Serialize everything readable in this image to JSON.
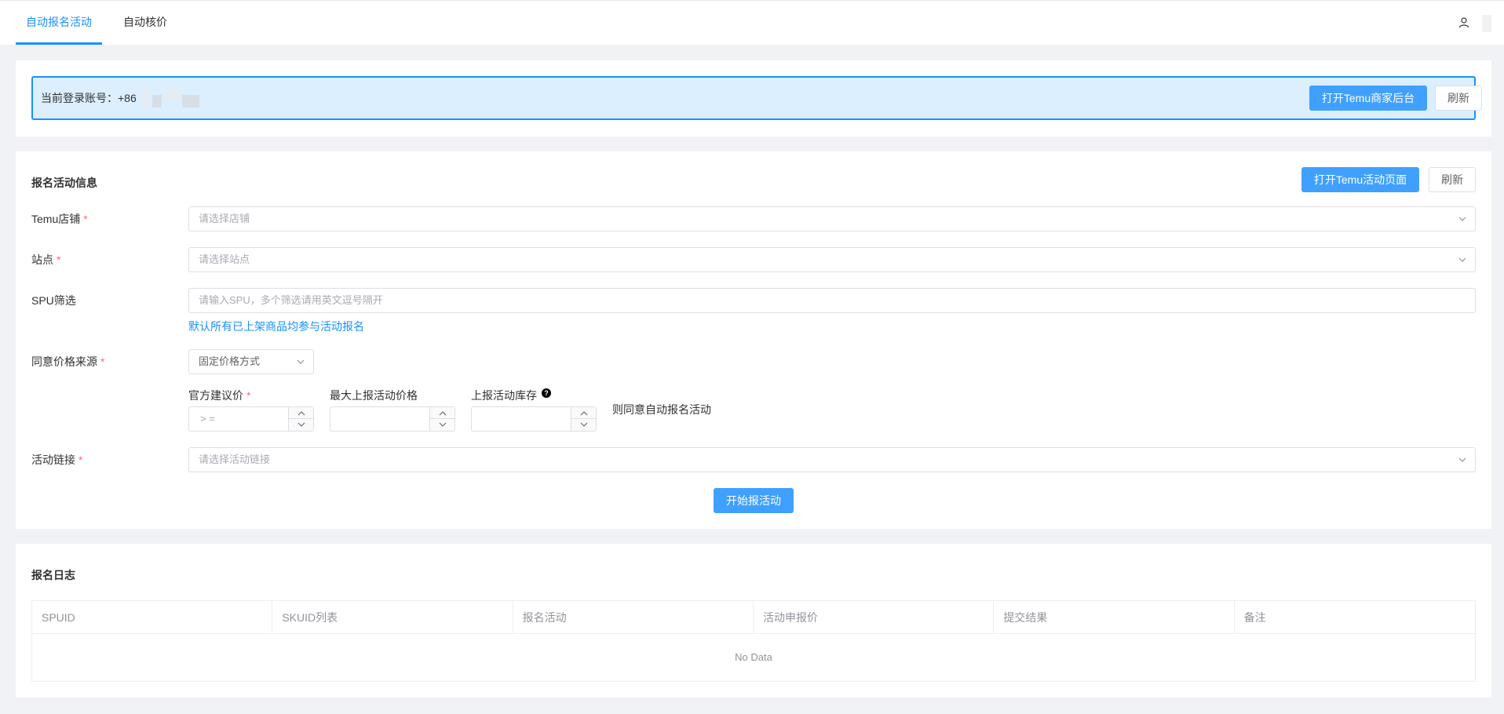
{
  "nav": {
    "tabs": [
      {
        "label": "自动报名活动",
        "active": true
      },
      {
        "label": "自动核价",
        "active": false
      }
    ]
  },
  "account": {
    "label": "当前登录账号：+86",
    "open_backend_label": "打开Temu商家后台",
    "refresh_label": "刷新"
  },
  "form": {
    "title": "报名活动信息",
    "open_activity_label": "打开Temu活动页面",
    "refresh_label": "刷新",
    "store": {
      "label": "Temu店铺",
      "placeholder": "请选择店铺"
    },
    "site": {
      "label": "站点",
      "placeholder": "请选择站点"
    },
    "spu": {
      "label": "SPU筛选",
      "placeholder": "请输入SPU，多个筛选请用英文逗号隔开",
      "hint": "默认所有已上架商品均参与活动报名"
    },
    "price_source": {
      "label": "同意价格来源",
      "value": "固定价格方式"
    },
    "official_price": {
      "label": "官方建议价",
      "placeholder": "> ="
    },
    "max_price": {
      "label": "最大上报活动价格"
    },
    "stock": {
      "label": "上报活动库存",
      "help": "?"
    },
    "agree_text": "则同意自动报名活动",
    "activity_link": {
      "label": "活动链接",
      "placeholder": "请选择活动链接"
    },
    "required_mark": "*",
    "submit_label": "开始报活动"
  },
  "log": {
    "title": "报名日志",
    "columns": [
      "SPUID",
      "SKUID列表",
      "报名活动",
      "活动申报价",
      "提交结果",
      "备注"
    ],
    "empty_text": "No Data"
  },
  "colors": {
    "primary": "#40a0ff",
    "banner_bg": "#dcefff",
    "required": "#f56c6c"
  },
  "icons": {
    "user": "user-icon",
    "chevron": "chevron-down-icon",
    "help": "question-circle-icon"
  }
}
